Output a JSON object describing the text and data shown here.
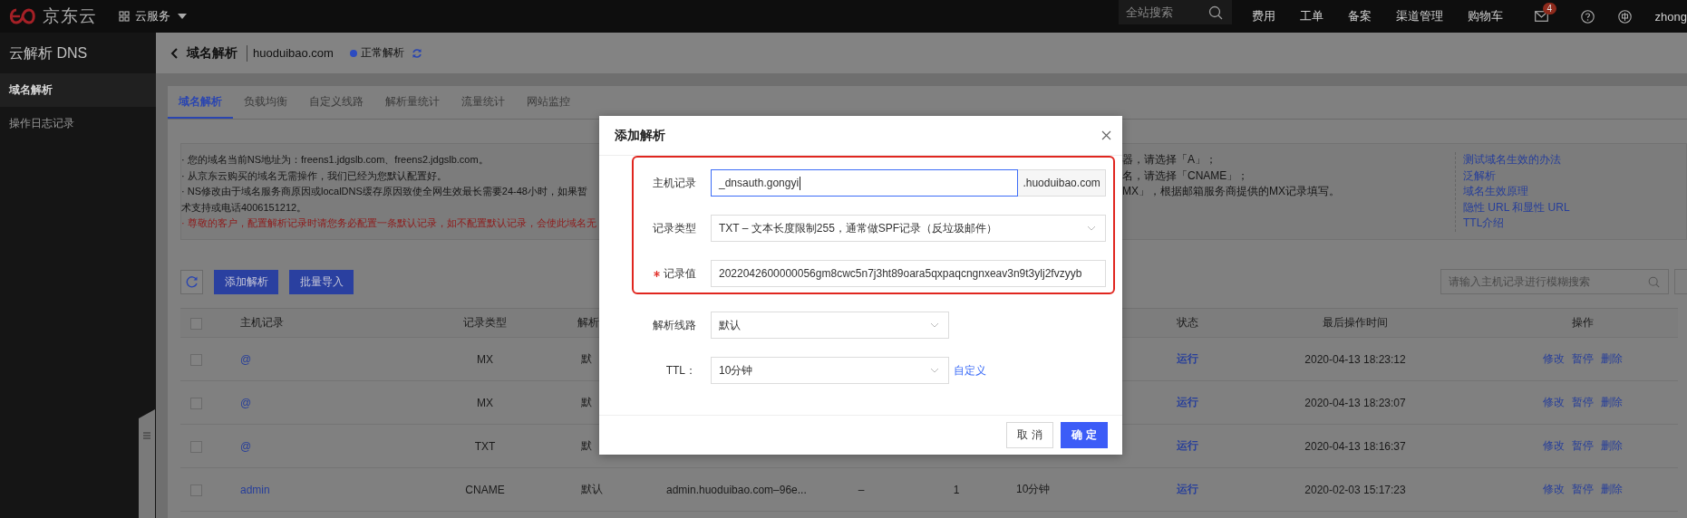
{
  "topbar": {
    "logo": "京东云",
    "product_menu": "云服务",
    "search": {
      "placeholder": "全站搜索"
    },
    "nav": [
      "费用",
      "工单",
      "备案",
      "渠道管理",
      "购物车"
    ],
    "mail_badge": "4",
    "user": "zhong"
  },
  "sidebar": {
    "title": "云解析 DNS",
    "items": [
      {
        "label": "域名解析",
        "selected": true
      },
      {
        "label": "操作日志记录",
        "selected": false
      }
    ]
  },
  "header": {
    "title": "域名解析",
    "domain": "huoduibao.com",
    "status": "正常解析"
  },
  "tabs": [
    {
      "label": "域名解析",
      "selected": true
    },
    {
      "label": "负载均衡",
      "selected": false
    },
    {
      "label": "自定义线路",
      "selected": false
    },
    {
      "label": "解析量统计",
      "selected": false
    },
    {
      "label": "流量统计",
      "selected": false
    },
    {
      "label": "网站监控",
      "selected": false
    }
  ],
  "notice": {
    "lines": [
      {
        "text": "· 您的域名当前NS地址为：freens1.jdgslb.com、freens2.jdgslb.com。",
        "kind": "normal"
      },
      {
        "text": "· 从京东云购买的域名无需操作，我们已经为您默认配置好。",
        "kind": "normal"
      },
      {
        "text": "· NS修改由于域名服务商原因或localDNS缓存原因致使全网生效最长需要24-48小时，如果暂",
        "kind": "normal"
      },
      {
        "text": "术支持或电话4006151212。",
        "kind": "normal"
      },
      {
        "text": "· 尊敬的客户，配置解析记录时请您务必配置一条默认记录，如不配置默认记录，会使此域名无",
        "kind": "warning"
      }
    ],
    "right_lines": [
      "器，请选择「A」；",
      "名，请选择「CNAME」；",
      "MX」，根据邮箱服务商提供的MX记录填写。"
    ],
    "links": [
      "测试域名生效的办法",
      "泛解析",
      "域名生效原理",
      "隐性 URL 和显性 URL",
      "TTL介绍"
    ]
  },
  "toolbar": {
    "buttons": [
      "添加解析",
      "批量导入"
    ],
    "search": {
      "placeholder": "请输入主机记录进行模糊搜索"
    }
  },
  "table": {
    "header": {
      "checked": false,
      "host": "主机记录",
      "type": "记录类型",
      "line": "解析",
      "status": "状态",
      "time": "最后操作时间",
      "actions": "操作"
    },
    "rows": [
      {
        "checked": false,
        "host": "@",
        "type": "MX",
        "line": "默",
        "status": "运行",
        "time": "2020-04-13 18:23:12",
        "actions": [
          "修改",
          "暂停",
          "删除"
        ]
      },
      {
        "checked": false,
        "host": "@",
        "type": "MX",
        "line": "默",
        "status": "运行",
        "time": "2020-04-13 18:23:07",
        "actions": [
          "修改",
          "暂停",
          "删除"
        ]
      },
      {
        "checked": false,
        "host": "@",
        "type": "TXT",
        "line": "默",
        "status": "运行",
        "time": "2020-04-13 18:16:37",
        "actions": [
          "修改",
          "暂停",
          "删除"
        ]
      },
      {
        "checked": false,
        "host": "admin",
        "type": "CNAME",
        "line": "默认",
        "value": "admin.huoduibao.com–96e...",
        "column_5": "–",
        "column_6": "1",
        "ttl": "10分钟",
        "status": "运行",
        "time": "2020-02-03 15:17:23",
        "actions": [
          "修改",
          "暂停",
          "删除"
        ]
      }
    ]
  },
  "modal": {
    "title": "添加解析",
    "highlighted_fields": [
      {
        "kind": "input",
        "label": "主机记录",
        "required": false,
        "focused": true,
        "value": "_dnsauth.gongyi",
        "suffix": ".huoduibao.com"
      },
      {
        "kind": "select",
        "label": "记录类型",
        "required": false,
        "value": "TXT – 文本长度限制255，通常做SPF记录（反垃圾邮件）"
      },
      {
        "kind": "input",
        "label": "记录值",
        "required": true,
        "focused": false,
        "value": "2022042600000056gm8cwc5n7j3ht89oara5qxpaqcngnxeav3n9t3ylj2fvzyyb"
      }
    ],
    "fields": [
      {
        "kind": "select",
        "label": "解析线路",
        "required": false,
        "value": "默认"
      },
      {
        "kind": "select",
        "label": "TTL：",
        "required": false,
        "value": "10分钟",
        "link": "自定义"
      }
    ],
    "buttons": [
      {
        "label": "取 消",
        "primary": false
      },
      {
        "label": "确 定",
        "primary": true
      }
    ]
  }
}
